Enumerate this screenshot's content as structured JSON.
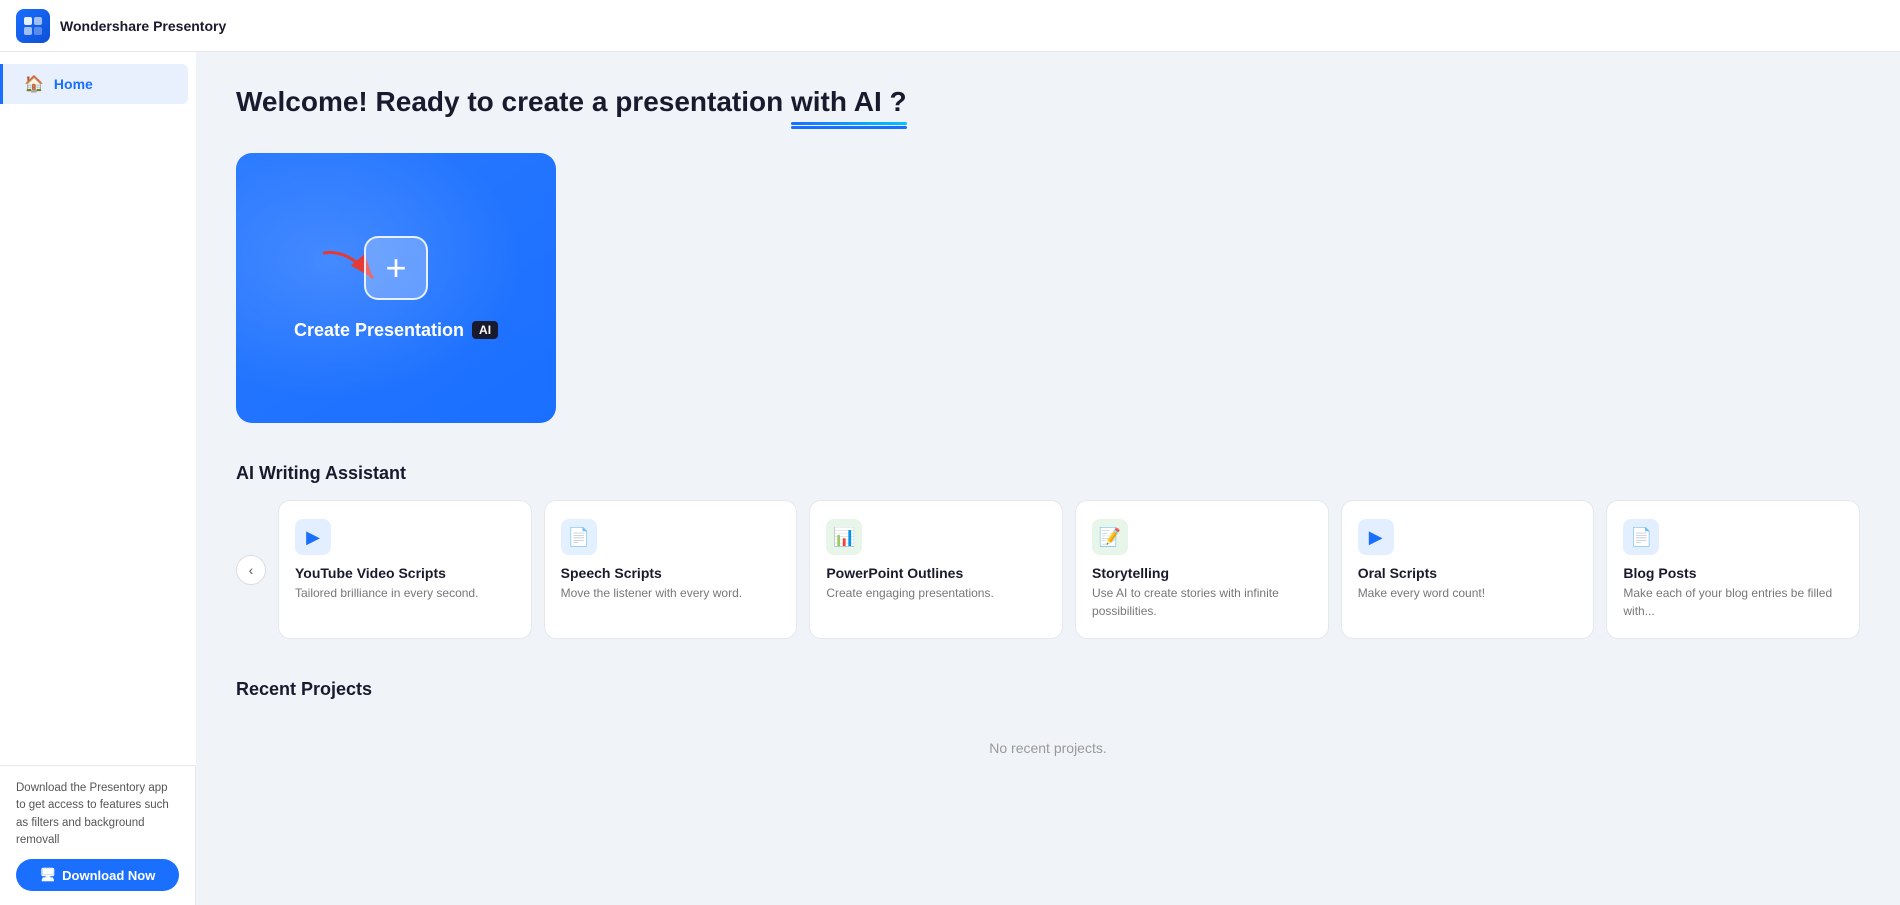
{
  "topbar": {
    "app_name": "Wondershare Presentory",
    "logo_symbol": "P"
  },
  "sidebar": {
    "items": [
      {
        "id": "home",
        "label": "Home",
        "icon": "🏠",
        "active": true
      }
    ],
    "download_promo": "Download the Presentory app to get access to features such as filters and background removall",
    "download_label": "Download Now"
  },
  "main": {
    "welcome_text_1": "Welcome! Ready to create a presentation",
    "welcome_with_ai": "with AI ?",
    "create_card": {
      "label": "Create Presentation",
      "ai_badge": "AI"
    },
    "ai_writing": {
      "section_title": "AI Writing Assistant",
      "cards": [
        {
          "id": "youtube",
          "title": "YouTube Video Scripts",
          "desc": "Tailored brilliance in every second.",
          "icon_type": "youtube"
        },
        {
          "id": "speech",
          "title": "Speech Scripts",
          "desc": "Move the listener with every word.",
          "icon_type": "speech"
        },
        {
          "id": "ppt",
          "title": "PowerPoint Outlines",
          "desc": "Create engaging presentations.",
          "icon_type": "ppt"
        },
        {
          "id": "story",
          "title": "Storytelling",
          "desc": "Use AI to create stories with infinite possibilities.",
          "icon_type": "story"
        },
        {
          "id": "oral",
          "title": "Oral Scripts",
          "desc": "Make every word count!",
          "icon_type": "oral"
        },
        {
          "id": "blog",
          "title": "Blog Posts",
          "desc": "Make each of your blog entries be filled with...",
          "icon_type": "blog"
        }
      ]
    },
    "recent": {
      "section_title": "Recent Projects",
      "no_recent_text": "No recent projects."
    }
  }
}
